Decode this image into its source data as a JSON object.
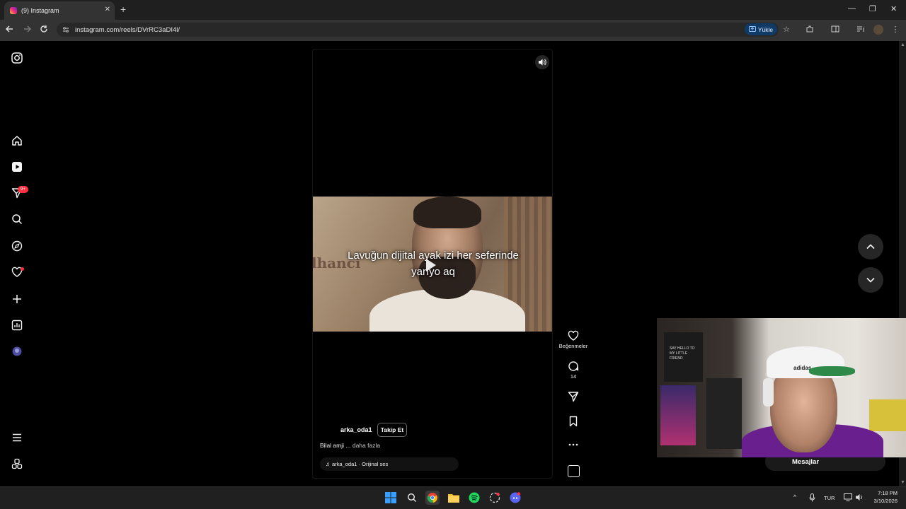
{
  "browser": {
    "tab_title": "(9) Instagram",
    "tab_close": "✕",
    "new_tab": "+",
    "url": "instagram.com/reels/DVrRC3aDI4l/",
    "upload_label": "Yükle",
    "window_controls": [
      "—",
      "❐",
      "✕"
    ]
  },
  "sidebar": {
    "items": [
      {
        "name": "instagram-logo-icon"
      },
      {
        "name": "home-icon"
      },
      {
        "name": "reels-icon"
      },
      {
        "name": "messages-icon"
      },
      {
        "name": "search-icon"
      },
      {
        "name": "explore-icon"
      },
      {
        "name": "notifications-icon"
      },
      {
        "name": "create-icon"
      },
      {
        "name": "dashboard-icon"
      },
      {
        "name": "profile-avatar"
      },
      {
        "name": "menu-icon"
      },
      {
        "name": "also-from-meta-icon"
      }
    ],
    "messages_badge": "9+"
  },
  "reel": {
    "overlay_text_line1": "Lavuğun dijital ayak izi her seferinde",
    "overlay_text_line2": "yarıyo aq",
    "bg_logo_text": "lhanci",
    "author": "arka_oda1",
    "follow_label": "Takip Et",
    "caption_text": "Bilal amji ...",
    "caption_more": "daha fazla",
    "audio_label": "arka_oda1 · Orijinal ses"
  },
  "actions": {
    "like_label": "Beğenmeler",
    "comment_count": "14"
  },
  "messages_pill": {
    "label": "Mesajlar"
  },
  "webcam": {
    "poster_text": "SAY HELLO TO MY LITTLE FRIEND",
    "cap_brand": "adidas"
  },
  "taskbar": {
    "lang": "TUR",
    "time": "7:18 PM",
    "date": "3/10/2026"
  },
  "colors": {
    "accent_notification": "#ff3040",
    "upload_button_bg": "#0f3a66"
  }
}
